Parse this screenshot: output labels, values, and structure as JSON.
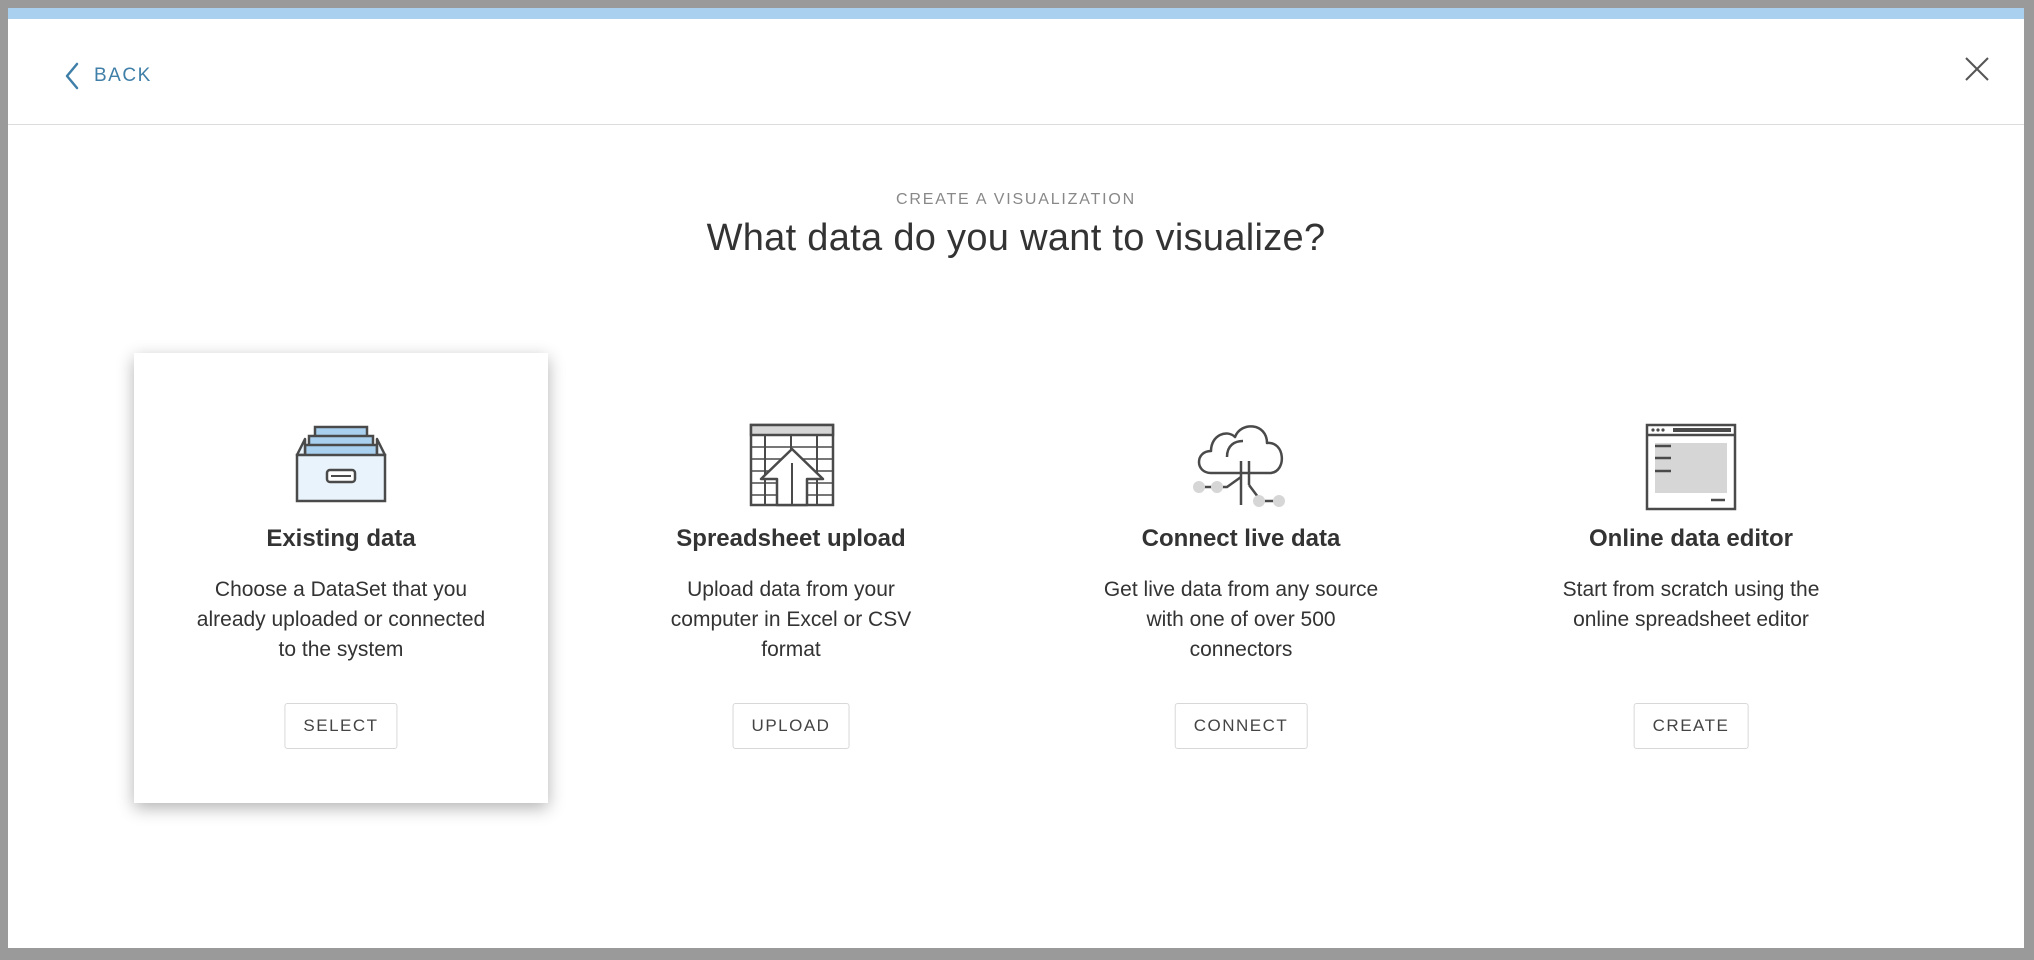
{
  "header": {
    "back_label": "BACK"
  },
  "heading": {
    "eyebrow": "CREATE A VISUALIZATION",
    "title": "What data do you want to visualize?"
  },
  "options": [
    {
      "name": "Existing data",
      "description": "Choose a DataSet that you already uploaded or connected to the system",
      "button": "SELECT",
      "icon": "file-drawer-icon",
      "selected": true
    },
    {
      "name": "Spreadsheet upload",
      "description": "Upload data from your computer in Excel or CSV format",
      "button": "UPLOAD",
      "icon": "spreadsheet-upload-icon"
    },
    {
      "name": "Connect live data",
      "description": "Get live data from any source with one of over 500 connectors",
      "button": "CONNECT",
      "icon": "cloud-connect-icon"
    },
    {
      "name": "Online data editor",
      "description": "Start from scratch using the online spreadsheet editor",
      "button": "CREATE",
      "icon": "browser-editor-icon"
    }
  ],
  "colors": {
    "accent_bar": "#a9d1ef",
    "link": "#3f7fa8",
    "icon_fill_blue": "#a9d1ef",
    "icon_stroke": "#4a4a4a",
    "icon_fill_gray": "#d6d6d6"
  }
}
